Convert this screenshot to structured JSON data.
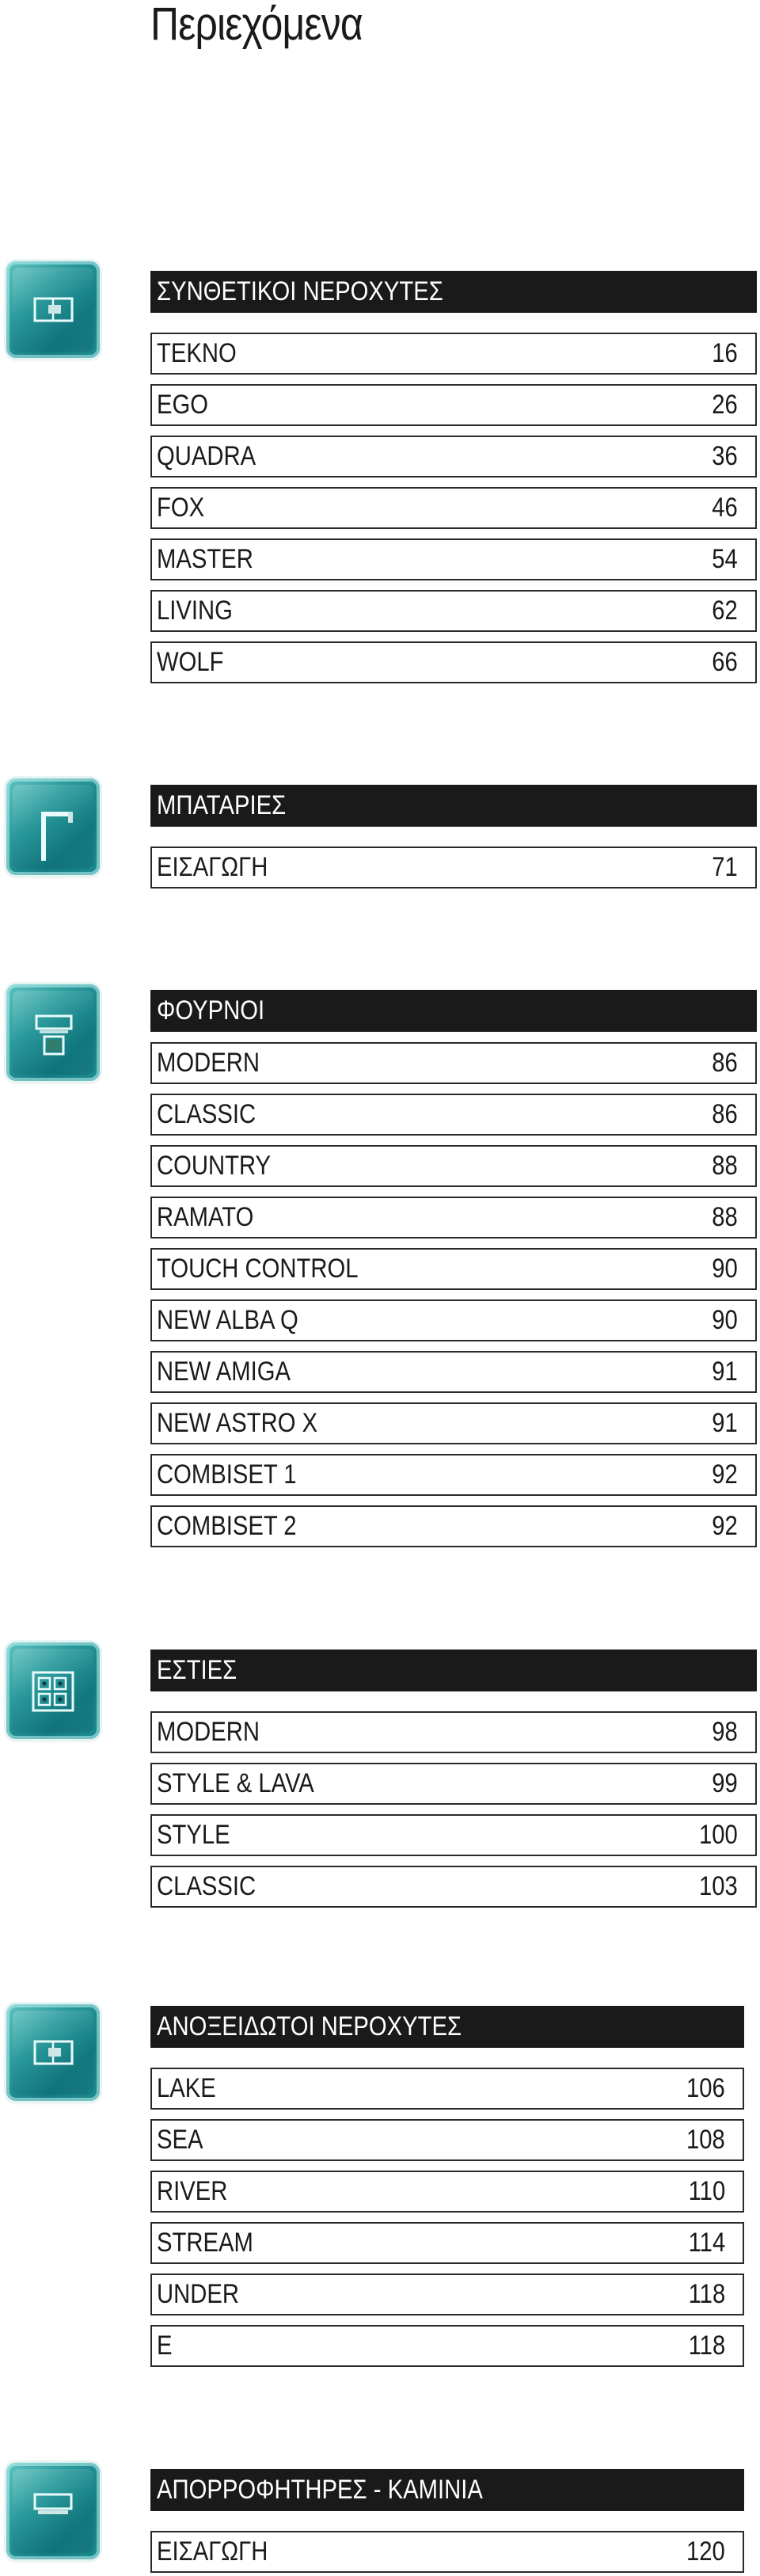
{
  "page_title": "Περιεχόμενα",
  "colors": {
    "header_bg": "#1b1a1a",
    "header_text": "#ffffff",
    "icon_teal": "#1d8d90",
    "row_border": "#2a2a2a"
  },
  "sections": [
    {
      "title": "ΣΥΝΘΕΤΙΚΟΙ ΝΕΡΟΧΥΤΕΣ",
      "icon": "sink-icon",
      "items": [
        {
          "name": "TEKNO",
          "page": "16"
        },
        {
          "name": "EGO",
          "page": "26"
        },
        {
          "name": "QUADRA",
          "page": "36"
        },
        {
          "name": "FOX",
          "page": "46"
        },
        {
          "name": "MASTER",
          "page": "54"
        },
        {
          "name": "LIVING",
          "page": "62"
        },
        {
          "name": "WOLF",
          "page": "66"
        }
      ]
    },
    {
      "title": "ΜΠΑΤΑΡΙΕΣ",
      "icon": "faucet-icon",
      "items": [
        {
          "name": "ΕΙΣΑΓΩΓΗ",
          "page": "71"
        }
      ]
    },
    {
      "title": "ΦΟΥΡΝΟΙ",
      "icon": "oven-icon",
      "items": [
        {
          "name": "MODERN",
          "page": "86"
        },
        {
          "name": "CLASSIC",
          "page": "86"
        },
        {
          "name": "COUNTRY",
          "page": "88"
        },
        {
          "name": "RAMATO",
          "page": "88"
        },
        {
          "name": "TOUCH CONTROL",
          "page": "90"
        },
        {
          "name": "NEW ALBA Q",
          "page": "90"
        },
        {
          "name": "NEW AMIGA",
          "page": "91"
        },
        {
          "name": "NEW ASTRO X",
          "page": "91"
        },
        {
          "name": "COMBISET 1",
          "page": "92"
        },
        {
          "name": "COMBISET 2",
          "page": "92"
        }
      ]
    },
    {
      "title": "ΕΣΤΙΕΣ",
      "icon": "hob-icon",
      "items": [
        {
          "name": "MODERN",
          "page": "98"
        },
        {
          "name": "STYLE & LAVA",
          "page": "99"
        },
        {
          "name": "STYLE",
          "page": "100"
        },
        {
          "name": "CLASSIC",
          "page": "103"
        }
      ]
    },
    {
      "title": "ΑΝΟΞΕΙΔΩΤΟΙ ΝΕΡΟΧΥΤΕΣ",
      "icon": "sink-icon",
      "items": [
        {
          "name": "LAKE",
          "page": "106"
        },
        {
          "name": "SEA",
          "page": "108"
        },
        {
          "name": "RIVER",
          "page": "110"
        },
        {
          "name": "STREAM",
          "page": "114"
        },
        {
          "name": "UNDER",
          "page": "118"
        },
        {
          "name": "E",
          "page": "118"
        }
      ]
    },
    {
      "title": "ΑΠΟΡΡΟΦΗΤΗΡΕΣ - ΚΑΜΙΝΙΑ",
      "icon": "hood-icon",
      "items": [
        {
          "name": "ΕΙΣΑΓΩΓΗ",
          "page": "120"
        }
      ]
    }
  ]
}
